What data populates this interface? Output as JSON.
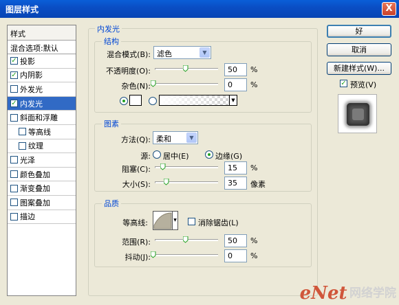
{
  "window": {
    "title": "图层样式",
    "close_glyph": "X"
  },
  "styles_panel": {
    "header": "样式",
    "blend_options": "混合选项:默认",
    "items": [
      {
        "label": "投影",
        "checked": true,
        "indent": false
      },
      {
        "label": "内阴影",
        "checked": true,
        "indent": false
      },
      {
        "label": "外发光",
        "checked": false,
        "indent": false
      },
      {
        "label": "内发光",
        "checked": true,
        "indent": false,
        "selected": true
      },
      {
        "label": "斜面和浮雕",
        "checked": false,
        "indent": false
      },
      {
        "label": "等高线",
        "checked": false,
        "indent": true
      },
      {
        "label": "纹理",
        "checked": false,
        "indent": true
      },
      {
        "label": "光泽",
        "checked": false,
        "indent": false
      },
      {
        "label": "颜色叠加",
        "checked": false,
        "indent": false
      },
      {
        "label": "渐变叠加",
        "checked": false,
        "indent": false
      },
      {
        "label": "图案叠加",
        "checked": false,
        "indent": false
      },
      {
        "label": "描边",
        "checked": false,
        "indent": false
      }
    ]
  },
  "inner_glow": {
    "title": "内发光",
    "structure": {
      "title": "结构",
      "blend_mode_label": "混合模式(B):",
      "blend_mode_value": "滤色",
      "opacity_label": "不透明度(O):",
      "opacity_value": "50",
      "opacity_unit": "%",
      "noise_label": "杂色(N):",
      "noise_value": "0",
      "noise_unit": "%"
    },
    "elements": {
      "title": "图素",
      "technique_label": "方法(Q):",
      "technique_value": "柔和",
      "source_label": "源:",
      "source_center": "居中(E)",
      "source_edge": "边缘(G)",
      "choke_label": "阻塞(C):",
      "choke_value": "15",
      "choke_unit": "%",
      "size_label": "大小(S):",
      "size_value": "35",
      "size_unit": "像素"
    },
    "quality": {
      "title": "品质",
      "contour_label": "等高线:",
      "antialias_label": "消除锯齿(L)",
      "range_label": "范围(R):",
      "range_value": "50",
      "range_unit": "%",
      "jitter_label": "抖动(J):",
      "jitter_value": "0",
      "jitter_unit": "%"
    }
  },
  "buttons": {
    "ok": "好",
    "cancel": "取消",
    "new_style": "新建样式(W)...",
    "preview_label": "预览(V)"
  },
  "watermark": {
    "logo": "eNet",
    "cn": "网络学院"
  }
}
